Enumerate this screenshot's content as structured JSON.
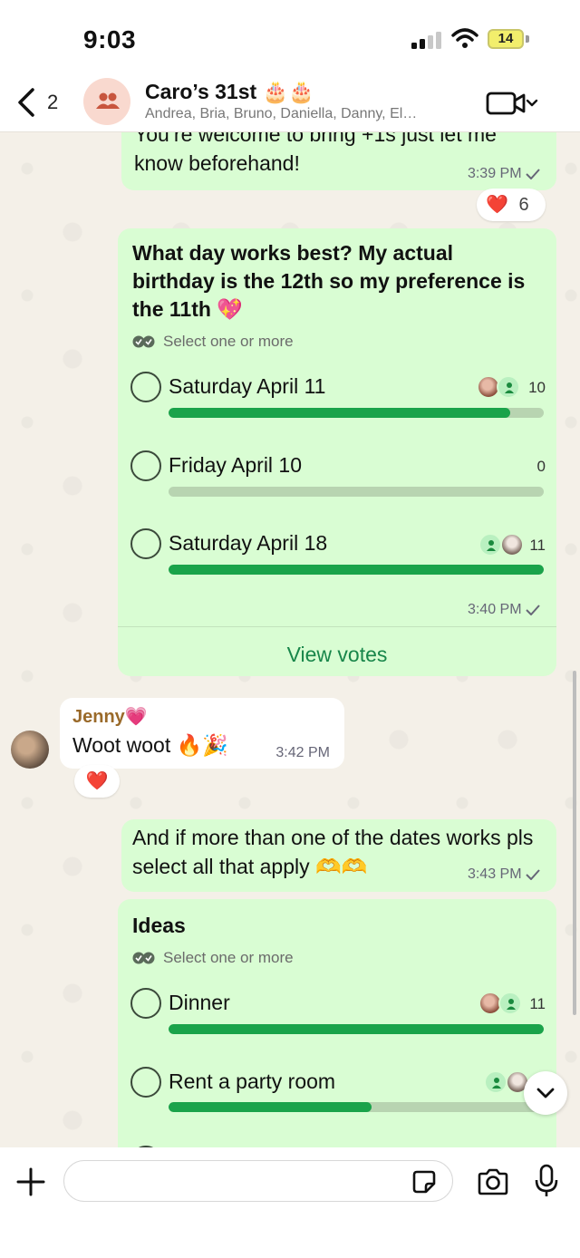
{
  "status_bar": {
    "time": "9:03",
    "battery": "14"
  },
  "header": {
    "back_count": "2",
    "title": "Caro’s 31st 🎂🎂",
    "participants": "Andrea, Bria, Bruno, Daniella, Danny, El…"
  },
  "messages": {
    "m1": {
      "text": "You’re welcome to bring +1s just let me know beforehand!",
      "time": "3:39 PM",
      "reaction": "❤️",
      "reaction_count": "6"
    },
    "poll1": {
      "question": "What day works best? My actual birthday is the 12th so my preference is the 11th 💖",
      "hint": "Select one or more",
      "options": [
        {
          "label": "Saturday April 11",
          "count": "10",
          "fraction": 0.91
        },
        {
          "label": "Friday April 10",
          "count": "0",
          "fraction": 0
        },
        {
          "label": "Saturday April 18",
          "count": "11",
          "fraction": 1.0
        }
      ],
      "time": "3:40 PM",
      "view_votes": "View votes"
    },
    "m2": {
      "sender": "Jenny💗",
      "text": "Woot woot 🔥🎉",
      "time": "3:42 PM",
      "reaction": "❤️"
    },
    "m3": {
      "text": "And if more than one of the dates works pls select all that apply 🫶🫶",
      "time": "3:43 PM"
    },
    "poll2": {
      "question": "Ideas",
      "hint": "Select one or more",
      "options": [
        {
          "label": "Dinner",
          "count": "11",
          "fraction": 1.0
        },
        {
          "label": "Rent a party room",
          "count": "",
          "fraction": 0.54
        }
      ]
    }
  },
  "composer": {
    "placeholder": ""
  },
  "colors": {
    "outgoing_bubble": "#d9fdd3",
    "poll_bar": "#1aa34a",
    "link_green": "#18864a"
  }
}
